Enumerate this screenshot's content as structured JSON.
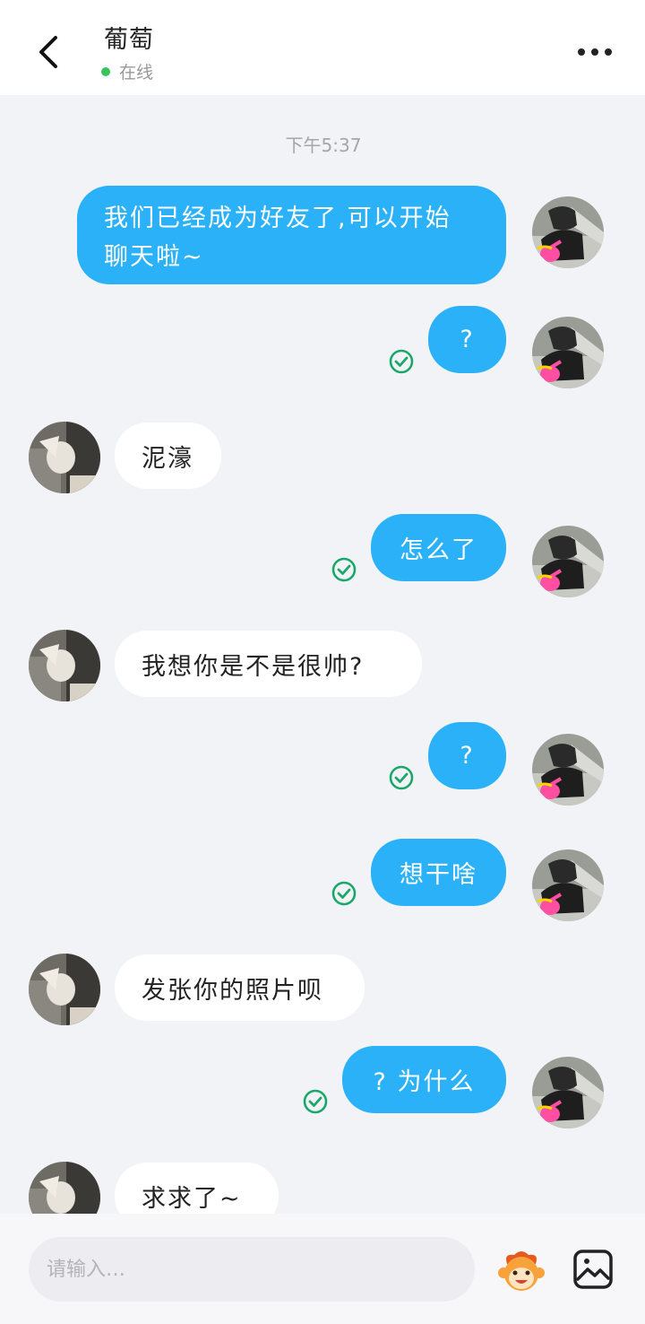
{
  "header": {
    "title": "葡萄",
    "status_text": "在线",
    "back_icon": "chevron-left-icon",
    "more_icon": "more-horizontal-icon"
  },
  "chat": {
    "timestamp": "下午5:37",
    "messages": [
      {
        "sender": "me",
        "line1": "我们已经成为好友了,可以开始",
        "line2": "聊天啦~"
      },
      {
        "sender": "me",
        "text": "?",
        "read": true
      },
      {
        "sender": "them",
        "text": "泥濠"
      },
      {
        "sender": "me",
        "text": "怎么了",
        "read": true
      },
      {
        "sender": "them",
        "text": "我想你是不是很帅?"
      },
      {
        "sender": "me",
        "text": "?",
        "read": true
      },
      {
        "sender": "me",
        "text": "想干啥",
        "read": true
      },
      {
        "sender": "them",
        "text": "发张你的照片呗"
      },
      {
        "sender": "me",
        "text": "? 为什么",
        "read": true
      },
      {
        "sender": "them",
        "text": "求求了~"
      }
    ]
  },
  "input_bar": {
    "placeholder": "请输入…",
    "emoji_icon": "monkey-emoji-icon",
    "image_icon": "image-icon"
  },
  "colors": {
    "mine_bubble": "#2bb1f7",
    "theirs_bubble": "#ffffff",
    "background": "#f1f3f7",
    "online_dot": "#37c45a",
    "read_check": "#1aa86a"
  }
}
